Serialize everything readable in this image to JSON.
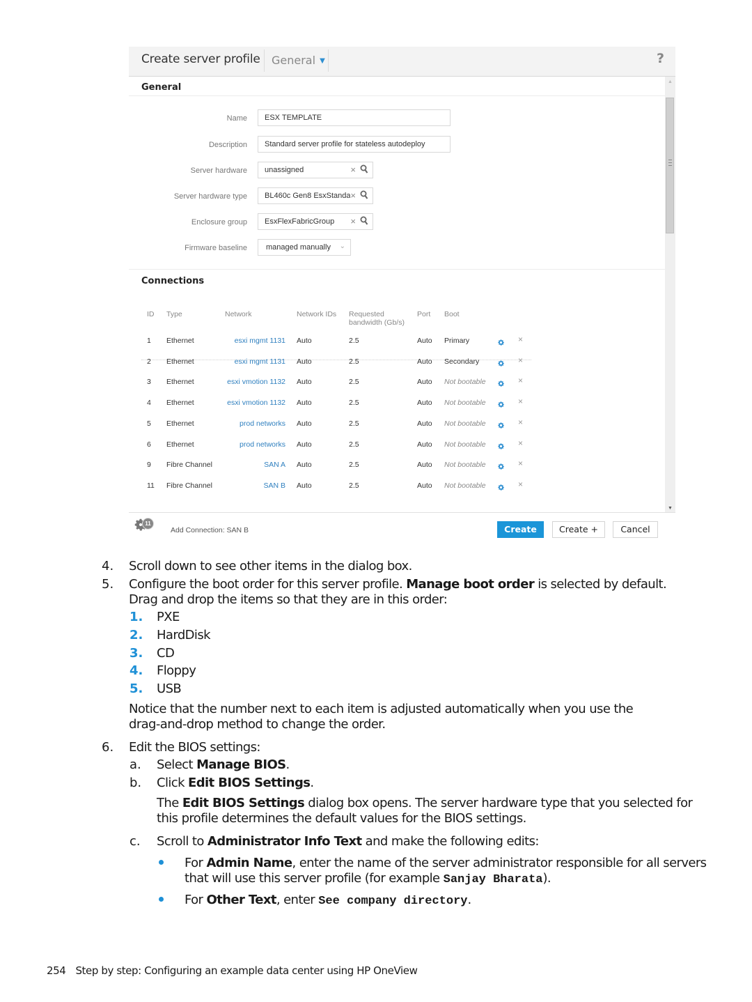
{
  "dialog": {
    "title": "Create server profile",
    "section_menu": "General",
    "help_label": "?",
    "general_heading": "General",
    "fields": [
      {
        "label": "Name",
        "value": "ESX TEMPLATE",
        "kind": "text"
      },
      {
        "label": "Description",
        "value": "Standard server profile for stateless autodeploy",
        "kind": "text"
      },
      {
        "label": "Server hardware",
        "value": "unassigned",
        "kind": "search"
      },
      {
        "label": "Server hardware type",
        "value": "BL460c Gen8 EsxStanda",
        "kind": "search"
      },
      {
        "label": "Enclosure group",
        "value": "EsxFlexFabricGroup",
        "kind": "search"
      },
      {
        "label": "Firmware baseline",
        "value": "managed manually",
        "kind": "select"
      }
    ],
    "connections_heading": "Connections",
    "columns": {
      "id": "ID",
      "type": "Type",
      "network": "Network",
      "network_ids": "Network IDs",
      "bandwidth_1": "Requested",
      "bandwidth_2": "bandwidth (Gb/s)",
      "port": "Port",
      "boot": "Boot"
    },
    "connections": [
      {
        "id": "1",
        "type": "Ethernet",
        "network": "esxi mgmt 1131",
        "network_ids": "Auto",
        "bandwidth": "2.5",
        "port": "Auto",
        "boot": "Primary",
        "bootable": true
      },
      {
        "id": "2",
        "type": "Ethernet",
        "network": "esxi mgmt 1131",
        "network_ids": "Auto",
        "bandwidth": "2.5",
        "port": "Auto",
        "boot": "Secondary",
        "bootable": true
      },
      {
        "id": "3",
        "type": "Ethernet",
        "network": "esxi vmotion 1132",
        "network_ids": "Auto",
        "bandwidth": "2.5",
        "port": "Auto",
        "boot": "Not bootable",
        "bootable": false
      },
      {
        "id": "4",
        "type": "Ethernet",
        "network": "esxi vmotion 1132",
        "network_ids": "Auto",
        "bandwidth": "2.5",
        "port": "Auto",
        "boot": "Not bootable",
        "bootable": false
      },
      {
        "id": "5",
        "type": "Ethernet",
        "network": "prod networks",
        "network_ids": "Auto",
        "bandwidth": "2.5",
        "port": "Auto",
        "boot": "Not bootable",
        "bootable": false
      },
      {
        "id": "6",
        "type": "Ethernet",
        "network": "prod networks",
        "network_ids": "Auto",
        "bandwidth": "2.5",
        "port": "Auto",
        "boot": "Not bootable",
        "bootable": false
      },
      {
        "id": "9",
        "type": "Fibre Channel",
        "network": "SAN A",
        "network_ids": "Auto",
        "bandwidth": "2.5",
        "port": "Auto",
        "boot": "Not bootable",
        "bootable": false
      },
      {
        "id": "11",
        "type": "Fibre Channel",
        "network": "SAN B",
        "network_ids": "Auto",
        "bandwidth": "2.5",
        "port": "Auto",
        "boot": "Not bootable",
        "bootable": false
      }
    ],
    "add_connection_label": "Add Connection",
    "activity_count": "11",
    "activity_text": "Add Connection: SAN B",
    "buttons": {
      "create": "Create",
      "create_plus": "Create +",
      "cancel": "Cancel"
    },
    "colors": {
      "accent": "#1b95d8",
      "link": "#2e7fbf"
    }
  },
  "doc": {
    "step4": {
      "num": "4.",
      "text": "Scroll down to see other items in the dialog box."
    },
    "step5": {
      "num": "5.",
      "pre": "Configure the boot order for this server profile. ",
      "bold": "Manage boot order",
      "post": " is selected by default.",
      "line2": "Drag and drop the items so that they are in this order:",
      "boot_order": [
        {
          "num": "1.",
          "label": "PXE"
        },
        {
          "num": "2.",
          "label": "HardDisk"
        },
        {
          "num": "3.",
          "label": "CD"
        },
        {
          "num": "4.",
          "label": "Floppy"
        },
        {
          "num": "5.",
          "label": "USB"
        }
      ],
      "notice_1": "Notice that the number next to each item is adjusted automatically when you use the",
      "notice_2": "drag-and-drop method to change the order."
    },
    "step6": {
      "num": "6.",
      "text": "Edit the BIOS settings:",
      "a": {
        "num": "a.",
        "pre": "Select ",
        "bold": "Manage BIOS",
        "post": "."
      },
      "b": {
        "num": "b.",
        "pre": "Click ",
        "bold": "Edit BIOS Settings",
        "post": "."
      },
      "b_note": {
        "pre": "The ",
        "bold": "Edit BIOS Settings",
        "post_1": " dialog box opens. The server hardware type that you selected for",
        "post_2": "this profile determines the default values for the BIOS settings."
      },
      "c": {
        "num": "c.",
        "pre": "Scroll to ",
        "bold": "Administrator Info Text",
        "post": " and make the following edits:"
      },
      "bullets": [
        {
          "pre": "For ",
          "bold": "Admin Name",
          "post_1": ", enter the name of the server administrator responsible for all servers",
          "post_2": "that will use this server profile (for example ",
          "code": "Sanjay Bharata",
          "post_3": ")."
        },
        {
          "pre": "For ",
          "bold": "Other Text",
          "post_1": ", enter ",
          "code": "See company directory",
          "post_2": "."
        }
      ]
    },
    "footer": {
      "page": "254",
      "title": "Step by step: Configuring an example data center using HP OneView"
    }
  }
}
